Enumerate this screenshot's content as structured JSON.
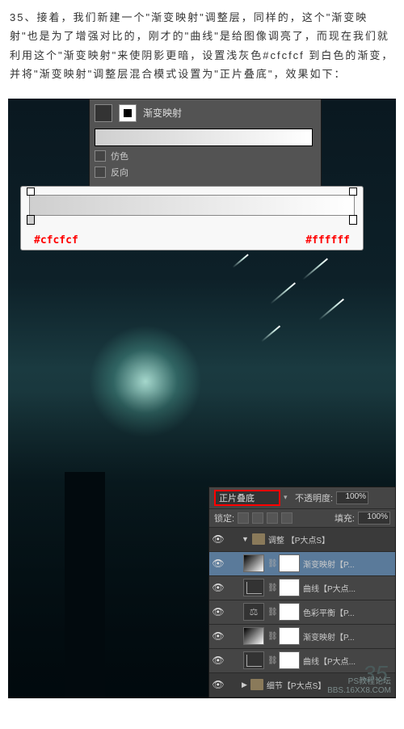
{
  "instruction": {
    "text": "35、接着，我们新建一个\"渐变映射\"调整层，同样的，这个\"渐变映射\"也是为了增强对比的，刚才的\"曲线\"是给图像调亮了，而现在我们就利用这个\"渐变映射\"来使阴影更暗，设置浅灰色#cfcfcf 到白色的渐变，并将\"渐变映射\"调整层混合模式设置为\"正片叠底\"，效果如下："
  },
  "panel1": {
    "title": "渐变映射",
    "dither": "仿色",
    "reverse": "反向"
  },
  "gradient_editor": {
    "hex_left": "#cfcfcf",
    "hex_right": "#ffffff"
  },
  "layers": {
    "blend_mode": "正片叠底",
    "opacity_label": "不透明度:",
    "opacity_value": "100%",
    "lock_label": "锁定:",
    "fill_label": "填充:",
    "fill_value": "100%",
    "group1": "调整 【P大点S】",
    "layer1": "渐变映射【P...",
    "layer2": "曲线【P大点...",
    "layer3": "色彩平衡【P...",
    "layer4": "渐变映射【P...",
    "layer5": "曲线【P大点...",
    "group2": "细节【P大点S】"
  },
  "watermark": {
    "line1": "PS教程论坛",
    "line2": "BBS.16XX8.COM"
  },
  "step": "35"
}
